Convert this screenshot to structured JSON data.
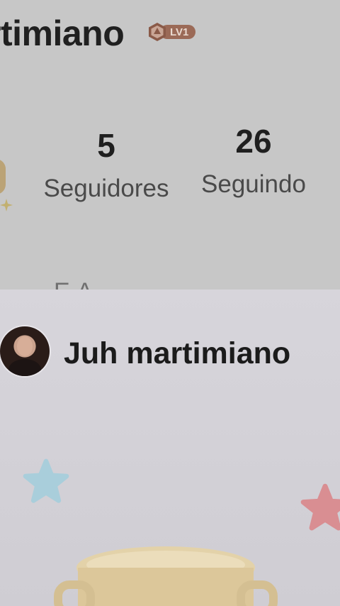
{
  "profile": {
    "username_partial": "rtimiano",
    "level_badge": "LV1",
    "followers": {
      "count": "5",
      "label": "Seguidores"
    },
    "following": {
      "count": "26",
      "label": "Seguindo"
    },
    "cut_text": "E          A"
  },
  "card": {
    "name": "Juh martimiano"
  },
  "icons": {
    "level": "hexagon-badge-icon",
    "blue_star": "star-icon",
    "pink_star": "star-icon",
    "trophy": "trophy-icon"
  },
  "colors": {
    "badge": "#9b6a57",
    "star_blue": "#a9cedb",
    "star_pink": "#d98e92",
    "trophy": "#e0cfa6"
  }
}
